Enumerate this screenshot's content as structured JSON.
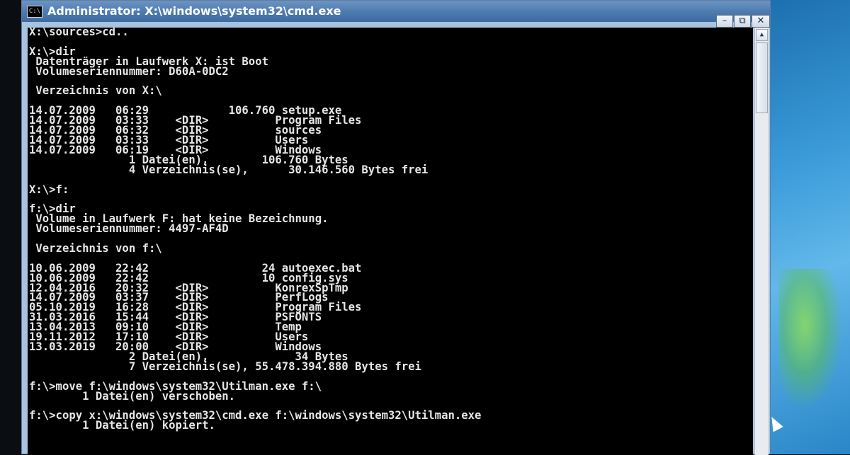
{
  "window": {
    "title": "Administrator: X:\\windows\\system32\\cmd.exe",
    "icon_label": "C:\\",
    "controls": {
      "minimize": "–",
      "maximize": "⧉",
      "close": "✕"
    }
  },
  "console": {
    "lines": [
      "X:\\sources>cd..",
      "",
      "X:\\>dir",
      " Datenträger in Laufwerk X: ist Boot",
      " Volumeseriennummer: D60A-0DC2",
      "",
      " Verzeichnis von X:\\",
      "",
      "14.07.2009   06:29            106.760 setup.exe",
      "14.07.2009   03:33    <DIR>          Program Files",
      "14.07.2009   06:32    <DIR>          sources",
      "14.07.2009   03:33    <DIR>          Users",
      "14.07.2009   06:19    <DIR>          Windows",
      "               1 Datei(en),        106.760 Bytes",
      "               4 Verzeichnis(se),      30.146.560 Bytes frei",
      "",
      "X:\\>f:",
      "",
      "f:\\>dir",
      " Volume in Laufwerk F: hat keine Bezeichnung.",
      " Volumeseriennummer: 4497-AF4D",
      "",
      " Verzeichnis von f:\\",
      "",
      "10.06.2009   22:42                 24 autoexec.bat",
      "10.06.2009   22:42                 10 config.sys",
      "12.04.2016   20:32    <DIR>          KonrexSpTmp",
      "14.07.2009   03:37    <DIR>          PerfLogs",
      "05.10.2019   16:28    <DIR>          Program Files",
      "31.03.2016   15:44    <DIR>          PSFONTS",
      "13.04.2013   09:10    <DIR>          Temp",
      "19.11.2012   17:10    <DIR>          Users",
      "13.03.2019   20:00    <DIR>          Windows",
      "               2 Datei(en),             34 Bytes",
      "               7 Verzeichnis(se), 55.478.394.880 Bytes frei",
      "",
      "f:\\>move f:\\windows\\system32\\Utilman.exe f:\\",
      "        1 Datei(en) verschoben.",
      "",
      "f:\\>copy x:\\windows\\system32\\cmd.exe f:\\windows\\system32\\Utilman.exe",
      "        1 Datei(en) kopiert."
    ]
  },
  "scrollbar": {
    "up_arrow": "▲"
  },
  "colors": {
    "console_bg": "#000000",
    "console_text": "#e6e6e6",
    "titlebar": "#4a78ad",
    "desktop": "#3a9ad8"
  }
}
